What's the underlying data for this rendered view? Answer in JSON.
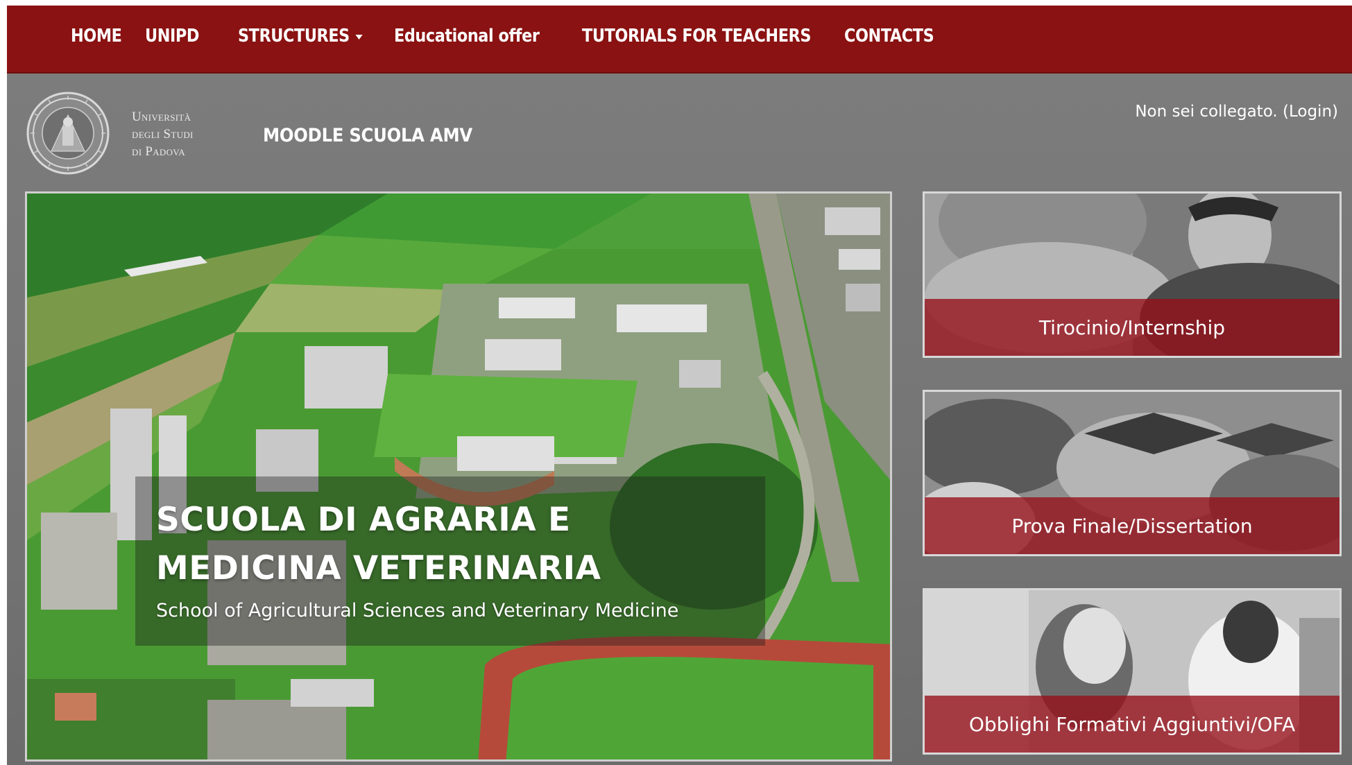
{
  "nav": {
    "items": [
      {
        "label": "HOME"
      },
      {
        "label": "UNIPD"
      },
      {
        "label": "STRUCTURES"
      },
      {
        "label": "Educational offer"
      },
      {
        "label": "TUTORIALS FOR TEACHERS"
      },
      {
        "label": "CONTACTS"
      }
    ]
  },
  "header": {
    "university": [
      "Università",
      "degli Studi",
      "di Padova"
    ],
    "site_title": "MOODLE SCUOLA AMV",
    "login_status": "Non sei collegato.",
    "login_link": "(Login)"
  },
  "hero": {
    "title_line1": "SCUOLA DI AGRARIA E",
    "title_line2": "MEDICINA VETERINARIA",
    "subtitle": "School of Agricultural Sciences and Veterinary Medicine"
  },
  "cards": [
    {
      "label": "Tirocinio/Internship",
      "icon": "students-photo"
    },
    {
      "label": "Prova Finale/Dissertation",
      "icon": "graduation-caps-photo"
    },
    {
      "label": "Obblighi Formativi Aggiuntivi/OFA",
      "icon": "students-studying-photo"
    }
  ],
  "colors": {
    "nav_bg": "#8a1212",
    "page_bg": "#777777",
    "card_band": "#960f19"
  }
}
